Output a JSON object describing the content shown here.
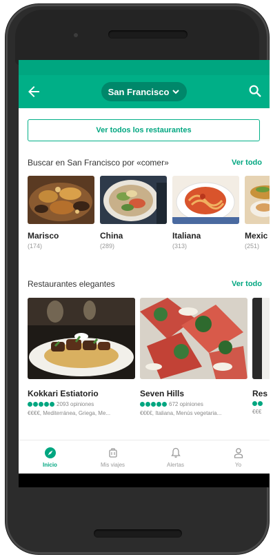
{
  "app_bar": {
    "city": "San Francisco"
  },
  "view_all_label": "Ver todos los restaurantes",
  "search_section": {
    "title": "Buscar en San Francisco por «comer»",
    "see_all": "Ver todo",
    "categories": [
      {
        "name": "Marisco",
        "count": "(174)"
      },
      {
        "name": "China",
        "count": "(289)"
      },
      {
        "name": "Italiana",
        "count": "(313)"
      },
      {
        "name": "Mexic",
        "count": "(251)"
      }
    ]
  },
  "elegant_section": {
    "title": "Restaurantes elegantes",
    "see_all": "Ver todo",
    "restaurants": [
      {
        "name": "Kokkari Estiatorio",
        "reviews": "2093 opiniones",
        "meta": "€€€€, Mediterránea, Griega, Me..."
      },
      {
        "name": "Seven Hills",
        "reviews": "672 opiniones",
        "meta": "€€€€, Italiana, Menús vegetaria..."
      },
      {
        "name": "Res",
        "reviews": "",
        "meta": "€€€"
      }
    ]
  },
  "bottom_nav": [
    {
      "label": "Inicio",
      "icon": "compass-icon",
      "active": true
    },
    {
      "label": "Mis viajes",
      "icon": "luggage-icon",
      "active": false
    },
    {
      "label": "Alertas",
      "icon": "bell-icon",
      "active": false
    },
    {
      "label": "Yo",
      "icon": "person-icon",
      "active": false
    }
  ],
  "colors": {
    "brand": "#00af87",
    "brand_dark": "#00876a",
    "status": "#00a680"
  }
}
